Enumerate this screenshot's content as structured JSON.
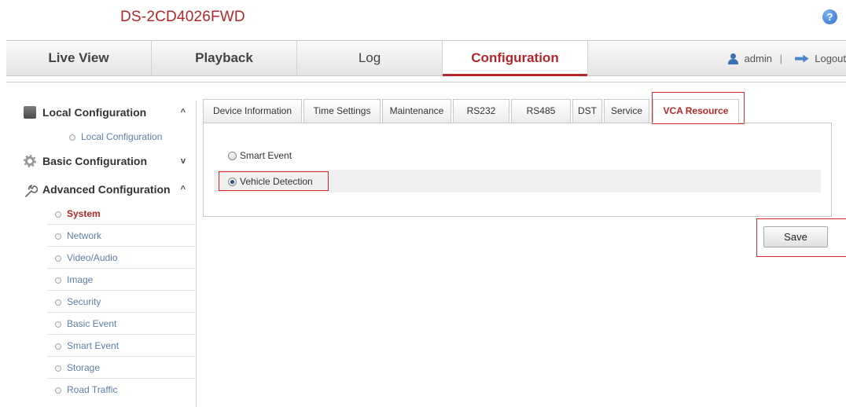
{
  "header": {
    "device_model": "DS-2CD4026FWD",
    "help_icon": "help-icon"
  },
  "nav": {
    "tabs": [
      {
        "label": "Live View",
        "active": false
      },
      {
        "label": "Playback",
        "active": false
      },
      {
        "label": "Log",
        "active": false
      },
      {
        "label": "Configuration",
        "active": true
      }
    ],
    "user": {
      "name": "admin",
      "separator": "|",
      "logout_label": "Logout"
    }
  },
  "sidebar": {
    "local": {
      "label": "Local Configuration",
      "chevron": "^",
      "items": [
        {
          "label": "Local Configuration"
        }
      ]
    },
    "basic": {
      "label": "Basic Configuration",
      "chevron": "v"
    },
    "advanced": {
      "label": "Advanced Configuration",
      "chevron": "^",
      "items": [
        {
          "label": "System",
          "active": true
        },
        {
          "label": "Network"
        },
        {
          "label": "Video/Audio"
        },
        {
          "label": "Image"
        },
        {
          "label": "Security"
        },
        {
          "label": "Basic Event"
        },
        {
          "label": "Smart Event"
        },
        {
          "label": "Storage"
        },
        {
          "label": "Road Traffic"
        }
      ]
    }
  },
  "tabs": [
    {
      "label": "Device Information"
    },
    {
      "label": "Time Settings"
    },
    {
      "label": "Maintenance"
    },
    {
      "label": "RS232"
    },
    {
      "label": "RS485"
    },
    {
      "label": "DST"
    },
    {
      "label": "Service"
    },
    {
      "label": "VCA Resource",
      "active": true
    }
  ],
  "vca": {
    "options": [
      {
        "label": "Smart Event",
        "checked": false
      },
      {
        "label": "Vehicle Detection",
        "checked": true
      }
    ]
  },
  "actions": {
    "save_label": "Save"
  },
  "colors": {
    "accent": "#b5262a",
    "highlight_box": "#d9262b",
    "link": "#5b7fa8"
  }
}
